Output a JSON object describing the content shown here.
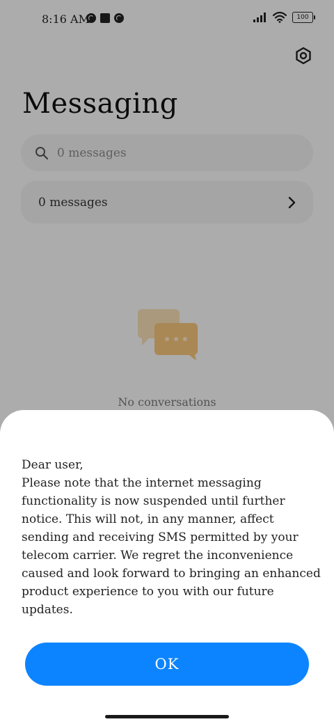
{
  "status_bar": {
    "time": "8:16 AM",
    "battery_level": "100"
  },
  "header": {
    "title": "Messaging",
    "settings_icon": "gear-icon"
  },
  "search": {
    "placeholder": "0 messages",
    "icon": "search-icon"
  },
  "messages_row": {
    "label": "0 messages",
    "icon": "chevron-right-icon"
  },
  "empty_state": {
    "icon": "chat-bubbles-icon",
    "text": "No conversations",
    "accent_color": "#f3c37a"
  },
  "dialog": {
    "message": "Dear user,\nPlease note that the internet messaging functionality is now suspended until further notice. This will not, in any manner, affect sending and receiving SMS permitted by your telecom carrier. We regret the inconvenience caused and look forward to bringing an enhanced product experience to you with our future updates.",
    "ok_label": "OK",
    "button_color": "#0d84ff"
  }
}
